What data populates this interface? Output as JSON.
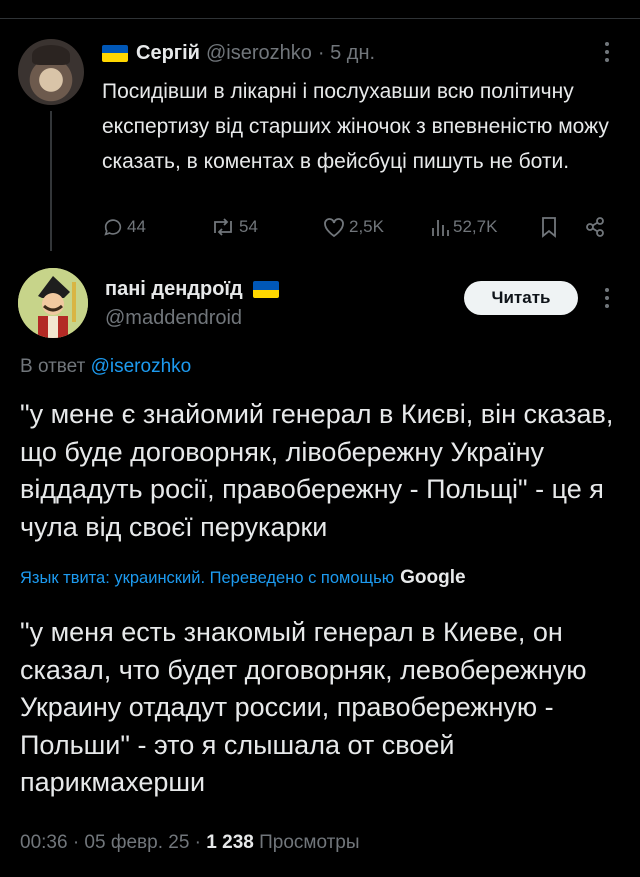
{
  "parent_tweet": {
    "name": "Сергій",
    "handle": "@iserozhko",
    "time": "· 5 дн.",
    "text": "Посидівши в лікарні і послухавши всю політичну експертизу від старших жіночок з впевненістю можу сказать, в коментах в фейсбуці пишуть не боти.",
    "replies": "44",
    "retweets": "54",
    "likes": "2,5K",
    "views": "52,7K"
  },
  "main_tweet": {
    "name": "пані дендроїд",
    "handle": "@maddendroid",
    "follow_label": "Читать",
    "reply_prefix": "В ответ ",
    "reply_handle": "@iserozhko",
    "text": "\"у мене є знайомий генерал в Києві, він сказав, що буде договорняк, лівобережну Україну віддадуть росії, правобережну - Польщі\" - це я чула від своєї перукарки",
    "translate_label": "Язык твита: украинский. Переведено с помощью",
    "translate_provider": "Google",
    "translated_text": "\"у меня есть знакомый генерал в Киеве, он сказал, что будет договорняк, левобережную Украину отдадут россии, правобережную - Польши\" - это я слышала от своей парикмахерши",
    "timestamp": "00:36 · 05 февр. 25 · ",
    "views_count": "1 238",
    "views_label": " Просмотры"
  },
  "colors": {
    "background": "#000000",
    "text": "#e7e9ea",
    "muted": "#71767b",
    "accent": "#1d9bf0",
    "flag_blue": "#0057b7",
    "flag_yellow": "#ffd700"
  }
}
